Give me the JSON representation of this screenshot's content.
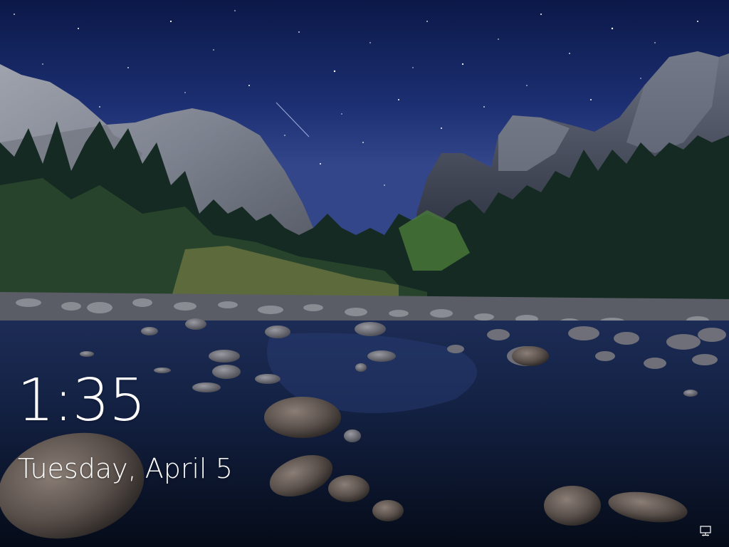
{
  "lock_screen": {
    "time": "1:35",
    "date": "Tuesday, April 5"
  },
  "status_icons": [
    {
      "icon": "network-icon"
    }
  ],
  "colors": {
    "text": "#ffffff",
    "sky_top": "#0c1a4a",
    "sky_horizon": "#2a3b7a",
    "water": "#0a1428"
  }
}
